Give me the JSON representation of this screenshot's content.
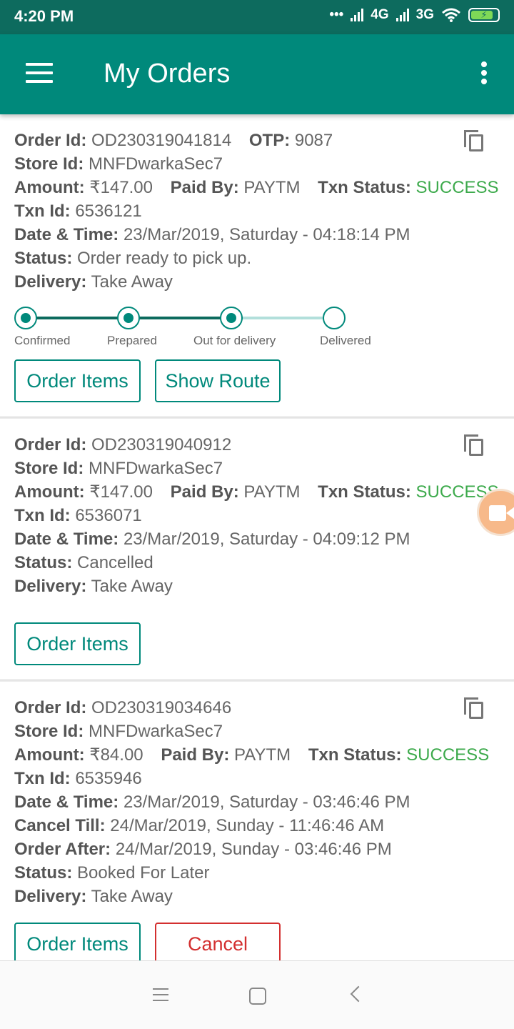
{
  "status_bar": {
    "time": "4:20 PM",
    "net1": "4G",
    "net2": "3G"
  },
  "app_bar": {
    "title": "My Orders"
  },
  "labels": {
    "order_id": "Order Id:",
    "otp": "OTP:",
    "store_id": "Store Id:",
    "amount": "Amount:",
    "paid_by": "Paid By:",
    "txn_status": "Txn Status:",
    "txn_id": "Txn Id:",
    "date_time": "Date & Time:",
    "cancel_till": "Cancel Till:",
    "order_after": "Order After:",
    "status": "Status:",
    "delivery": "Delivery:"
  },
  "orders": [
    {
      "order_id": "OD230319041814",
      "otp": "9087",
      "store_id": "MNFDwarkaSec7",
      "amount": "₹147.00",
      "paid_by": "PAYTM",
      "txn_status": "SUCCESS",
      "txn_id": "6536121",
      "date_time": "23/Mar/2019, Saturday - 04:18:14 PM",
      "status": "Order ready to pick up.",
      "delivery": "Take Away",
      "progress": {
        "steps": [
          "Confirmed",
          "Prepared",
          "Out for delivery",
          "Delivered"
        ],
        "completed": 3
      },
      "buttons": [
        "Order Items",
        "Show Route"
      ]
    },
    {
      "order_id": "OD230319040912",
      "store_id": "MNFDwarkaSec7",
      "amount": "₹147.00",
      "paid_by": "PAYTM",
      "txn_status": "SUCCESS",
      "txn_id": "6536071",
      "date_time": "23/Mar/2019, Saturday - 04:09:12 PM",
      "status": "Cancelled",
      "delivery": "Take Away",
      "buttons": [
        "Order Items"
      ]
    },
    {
      "order_id": "OD230319034646",
      "store_id": "MNFDwarkaSec7",
      "amount": "₹84.00",
      "paid_by": "PAYTM",
      "txn_status": "SUCCESS",
      "txn_id": "6535946",
      "date_time": "23/Mar/2019, Saturday - 03:46:46 PM",
      "cancel_till": "24/Mar/2019, Sunday - 11:46:46 AM",
      "order_after": "24/Mar/2019, Sunday - 03:46:46 PM",
      "status": "Booked For Later",
      "delivery": "Take Away",
      "buttons": [
        "Order Items",
        "Cancel"
      ]
    }
  ],
  "colors": {
    "primary": "#00897b",
    "status_bar": "#0d6b5e",
    "success": "#3daa4c",
    "cancel": "#d32f2f"
  },
  "icons": [
    "menu-icon",
    "overflow-icon",
    "copy-icon",
    "video-call-icon",
    "nav-menu-icon",
    "nav-home-icon",
    "nav-back-icon"
  ]
}
